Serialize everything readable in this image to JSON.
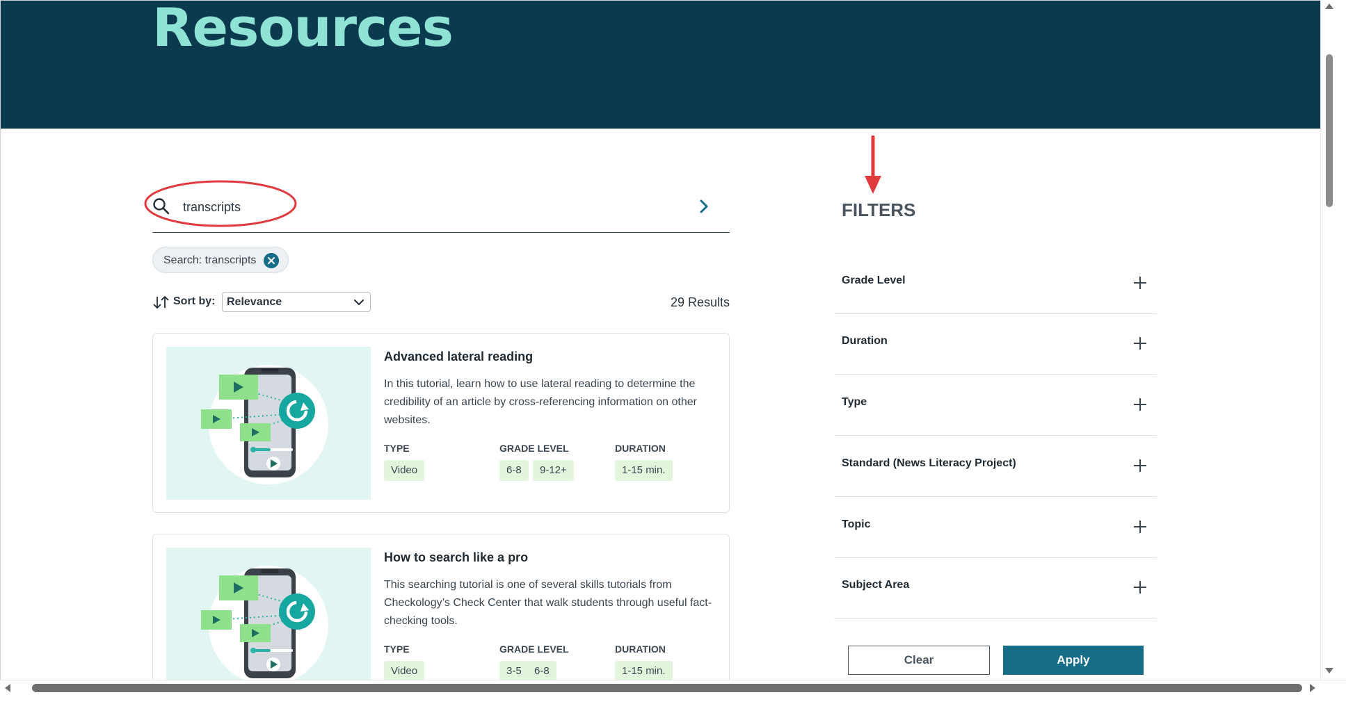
{
  "hero": {
    "title": "Resources"
  },
  "search": {
    "value": "transcripts",
    "placeholder": ""
  },
  "active_filter_chip": {
    "label": "Search: transcripts"
  },
  "sort": {
    "label": "Sort by:",
    "selected": "Relevance"
  },
  "results": {
    "count": "29 Results"
  },
  "cards": [
    {
      "title": "Advanced lateral reading",
      "description": "In this tutorial, learn how to use lateral reading to determine the credibility of an article by cross-referencing information on other websites.",
      "type_label": "TYPE",
      "grade_label": "GRADE LEVEL",
      "duration_label": "DURATION",
      "type": "Video",
      "grades": [
        "6-8",
        "9-12+"
      ],
      "duration": "1-15 min."
    },
    {
      "title": "How to search like a pro",
      "description": "This searching tutorial is one of several skills tutorials from Checkology’s Check Center that walk students through useful fact-checking tools.",
      "type_label": "TYPE",
      "grade_label": "GRADE LEVEL",
      "duration_label": "DURATION",
      "type": "Video",
      "grades": [
        "3-5",
        "6-8"
      ],
      "duration": "1-15 min."
    }
  ],
  "filters": {
    "title": "FILTERS",
    "items": [
      "Grade Level",
      "Duration",
      "Type",
      "Standard (News Literacy Project)",
      "Topic",
      "Subject Area"
    ],
    "clear_label": "Clear",
    "apply_label": "Apply"
  },
  "colors": {
    "hero_bg": "#0b3a4f",
    "hero_title": "#8fe3d4",
    "accent": "#176d88",
    "tag_bg": "#e3f5dc",
    "thumb_bg": "#e1f6f2",
    "annotation_red": "#e0393e"
  },
  "icons": {
    "search": "search-icon",
    "submit": "chevron-right-icon",
    "chip_close": "close-icon",
    "sort": "sort-arrows-icon",
    "select": "chevron-down-icon",
    "expand": "plus-icon"
  }
}
